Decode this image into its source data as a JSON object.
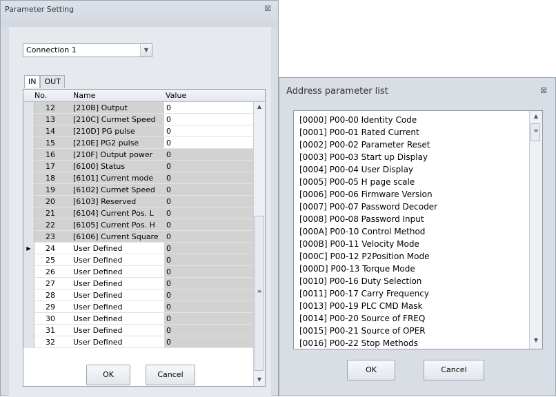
{
  "param_window": {
    "title": "Parameter Setting",
    "close_glyph": "☒",
    "connection": "Connection 1",
    "tabs": [
      "IN",
      "OUT"
    ],
    "columns": [
      "No.",
      "Name",
      "Value"
    ],
    "rows": [
      {
        "no": "12",
        "name": "[210B] Output",
        "value": "0",
        "style": "white"
      },
      {
        "no": "13",
        "name": "[210C] Curmet Speed",
        "value": "0",
        "style": "white"
      },
      {
        "no": "14",
        "name": "[210D] PG pulse",
        "value": "0",
        "style": "white"
      },
      {
        "no": "15",
        "name": "[210E] PG2 pulse",
        "value": "0",
        "style": "white"
      },
      {
        "no": "16",
        "name": "[210F] Output power",
        "value": "0",
        "style": "grey"
      },
      {
        "no": "17",
        "name": "[6100] Status",
        "value": "0",
        "style": "grey"
      },
      {
        "no": "18",
        "name": "[6101] Current mode",
        "value": "0",
        "style": "grey"
      },
      {
        "no": "19",
        "name": "[6102] Curmet Speed",
        "value": "0",
        "style": "grey"
      },
      {
        "no": "20",
        "name": "[6103] Reserved",
        "value": "0",
        "style": "grey"
      },
      {
        "no": "21",
        "name": "[6104] Current Pos. L",
        "value": "0",
        "style": "grey"
      },
      {
        "no": "22",
        "name": "[6105] Current Pos. H",
        "value": "0",
        "style": "grey"
      },
      {
        "no": "23",
        "name": "[6106] Current Square",
        "value": "0",
        "style": "grey"
      },
      {
        "no": "24",
        "name": "User Defined",
        "value": "0",
        "style": "user"
      },
      {
        "no": "25",
        "name": "User Defined",
        "value": "0",
        "style": "user"
      },
      {
        "no": "26",
        "name": "User Defined",
        "value": "0",
        "style": "user"
      },
      {
        "no": "27",
        "name": "User Defined",
        "value": "0",
        "style": "user"
      },
      {
        "no": "28",
        "name": "User Defined",
        "value": "0",
        "style": "user"
      },
      {
        "no": "29",
        "name": "User Defined",
        "value": "0",
        "style": "user"
      },
      {
        "no": "30",
        "name": "User Defined",
        "value": "0",
        "style": "user"
      },
      {
        "no": "31",
        "name": "User Defined",
        "value": "0",
        "style": "user"
      },
      {
        "no": "32",
        "name": "User Defined",
        "value": "0",
        "style": "user"
      }
    ],
    "current_row_index": 12,
    "ok_label": "OK",
    "cancel_label": "Cancel"
  },
  "address_window": {
    "title": "Address parameter list",
    "close_glyph": "☒",
    "items": [
      "[0000] P00-00 Identity Code",
      "[0001] P00-01 Rated Current",
      "[0002] P00-02 Parameter Reset",
      "[0003] P00-03 Start up Display",
      "[0004] P00-04 User Display",
      "[0005] P00-05 H page scale",
      "[0006] P00-06 Firmware Version",
      "[0007] P00-07 Password Decoder",
      "[0008] P00-08 Password Input",
      "[000A] P00-10 Control Method",
      "[000B] P00-11 Velocity Mode",
      "[000C] P00-12 P2Position Mode",
      "[000D] P00-13 Torque Mode",
      "[0010] P00-16 Duty Selection",
      "[0011] P00-17 Carry Frequency",
      "[0013] P00-19 PLC CMD Mask",
      "[0014] P00-20 Source of FREQ",
      "[0015] P00-21 Source of OPER",
      "[0016] P00-22 Stop Methods"
    ],
    "ok_label": "OK",
    "cancel_label": "Cancel"
  }
}
